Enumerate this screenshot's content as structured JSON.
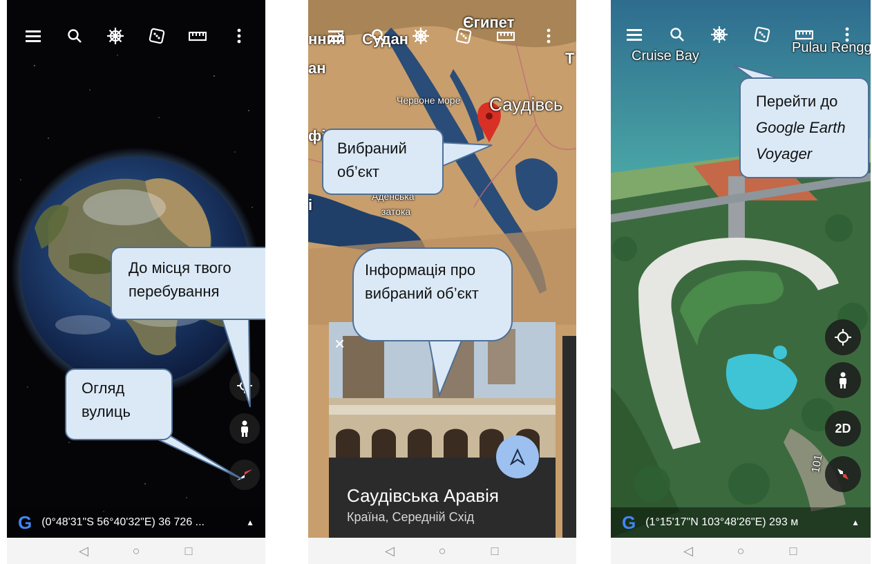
{
  "phones": [
    {
      "coord": "(0°48'31\"S 56°40'32\"E) 36 726 ...",
      "callouts": {
        "location": "До місця твого перебування",
        "street": "Огляд вулиць"
      }
    },
    {
      "map_labels": {
        "left_top": "нний",
        "sudan": "Судан",
        "egypt": "Єгипет",
        "left_second": "ан",
        "t_edge": "Т",
        "red_sea": "Червоне море",
        "saudi_map": "Саудівсь",
        "fi": "фі",
        "aden_1": "Аденська",
        "aden_2": "затока",
        "i_edge": "і"
      },
      "callouts": {
        "selected": "Вибраний об’єкт",
        "info": "Інформація про вибраний об’єкт"
      },
      "card": {
        "title": "Саудівська Аравія",
        "subtitle": "Країна, Середній Схід",
        "close": "×"
      }
    },
    {
      "map_labels": {
        "cruise_bay": "Cruise Bay",
        "pulau": "Pulau Rengg",
        "road_101": "101"
      },
      "callouts": {
        "voyager_1": "Перейти до",
        "voyager_2": "Google Earth",
        "voyager_3": "Voyager"
      },
      "btn_2d": "2D",
      "coord": "(1°15'17\"N 103°48'26\"E) 293 м"
    }
  ],
  "google_logo": "G",
  "colors": {
    "callout_fill": "#dbe9f7",
    "callout_border": "#4e6f95",
    "fab_bg": "#1e1e1e",
    "compass_red": "#e8453c",
    "pin_red": "#d93025",
    "direction_fab": "#9cc0f0"
  },
  "icons": [
    "menu-icon",
    "search-icon",
    "ship-wheel-icon",
    "dice-icon",
    "ruler-icon",
    "more-vert-icon",
    "my-location-icon",
    "pegman-icon",
    "compass-icon",
    "navigation-arrow-icon",
    "back-triangle-icon",
    "home-circle-icon",
    "recents-square-icon"
  ]
}
